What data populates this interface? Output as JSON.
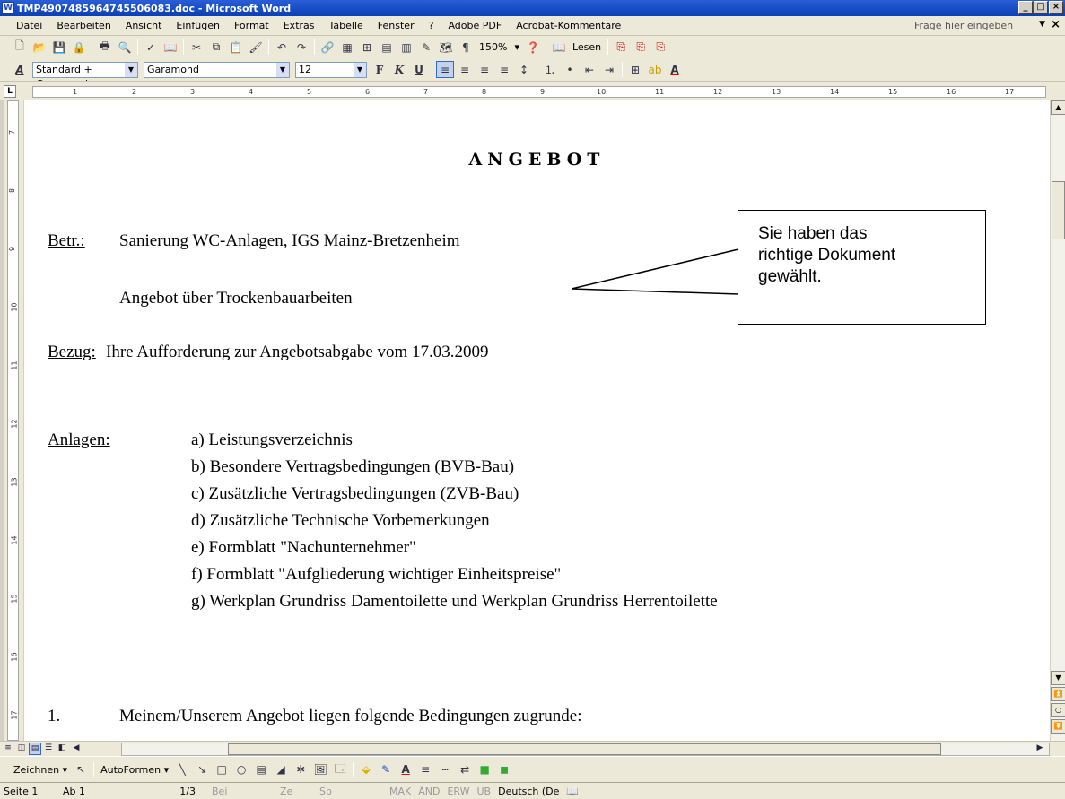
{
  "window": {
    "title": "TMP4907485964745506083.doc - Microsoft Word",
    "app_icon": "W",
    "controls": [
      "_",
      "□",
      "×"
    ]
  },
  "menu": {
    "items": [
      "Datei",
      "Bearbeiten",
      "Ansicht",
      "Einfügen",
      "Format",
      "Extras",
      "Tabelle",
      "Fenster",
      "?",
      "Adobe PDF",
      "Acrobat-Kommentare"
    ],
    "help_placeholder": "Frage hier eingeben",
    "close_doc": "×"
  },
  "toolbar_standard": {
    "zoom": "150%",
    "read_label": "Lesen"
  },
  "toolbar_format": {
    "style": "Standard + Garamond",
    "font": "Garamond",
    "size": "12",
    "bold": "F",
    "italic": "K",
    "underline": "U"
  },
  "ruler": {
    "h_ticks": [
      "1",
      "2",
      "3",
      "4",
      "5",
      "6",
      "7",
      "8",
      "9",
      "10",
      "11",
      "12",
      "13",
      "14",
      "15",
      "16",
      "17"
    ],
    "v_ticks": [
      "7",
      "8",
      "9",
      "10",
      "11",
      "12",
      "13",
      "14",
      "15",
      "16",
      "17"
    ]
  },
  "document": {
    "heading": "ANGEBOT",
    "betr_label": "Betr.:",
    "betr_value": "Sanierung WC-Anlagen, IGS Mainz-Bretzenheim",
    "betr_value2": "Angebot über Trockenbauarbeiten",
    "bezug_label": "Bezug:",
    "bezug_value": "Ihre Aufforderung zur Angebotsabgabe vom 17.03.2009",
    "anlagen_label": "Anlagen:",
    "anlagen": [
      "a) Leistungsverzeichnis",
      "b) Besondere Vertragsbedingungen   (BVB-Bau)",
      "c) Zusätzliche Vertragsbedingungen  (ZVB-Bau)",
      "d) Zusätzliche Technische Vorbemerkungen",
      "e) Formblatt \"Nachunternehmer\"",
      "f) Formblatt \"Aufgliederung wichtiger Einheitspreise\"",
      "g) Werkplan Grundriss Damentoilette und Werkplan Grundriss Herrentoilette"
    ],
    "section_number": "1.",
    "section_text": "Meinem/Unserem Angebot liegen folgende Bedingungen zugrunde:"
  },
  "callout": {
    "text": "Sie haben das\nrichtige Dokument\ngewählt."
  },
  "drawing_toolbar": {
    "zeichnen": "Zeichnen ▾",
    "autoformen": "AutoFormen ▾"
  },
  "status": {
    "page": "Seite 1",
    "section": "Ab 1",
    "pages": "1/3",
    "at": "Bei",
    "line": "Ze",
    "col": "Sp",
    "mak": "MAK",
    "aend": "ÄND",
    "erw": "ERW",
    "ueb": "ÜB",
    "language": "Deutsch (De"
  }
}
